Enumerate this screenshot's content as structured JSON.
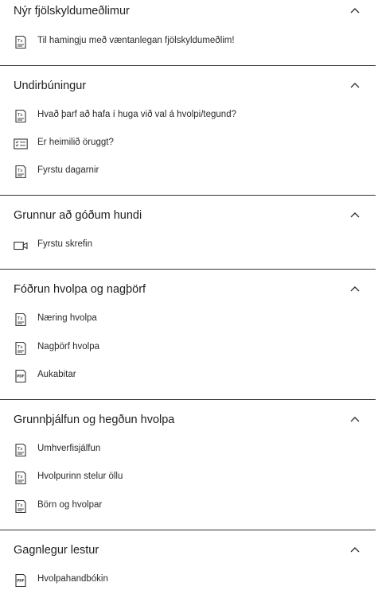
{
  "sections": [
    {
      "title": "Nýr fjölskyldumeðlimur",
      "items": [
        {
          "label": "Til hamingju með væntanlegan fjölskyldumeðlim!",
          "icon": "text-document-icon"
        }
      ]
    },
    {
      "title": "Undirbúningur",
      "items": [
        {
          "label": "Hvað þarf að hafa í huga við val á hvolpi/tegund?",
          "icon": "text-document-icon"
        },
        {
          "label": "Er heimilið öruggt?",
          "icon": "checklist-icon"
        },
        {
          "label": "Fyrstu dagarnir",
          "icon": "text-document-icon"
        }
      ]
    },
    {
      "title": "Grunnur að góðum hundi",
      "items": [
        {
          "label": "Fyrstu skrefin",
          "icon": "video-icon"
        }
      ]
    },
    {
      "title": "Fóðrun hvolpa og nagþörf",
      "items": [
        {
          "label": "Næring hvolpa",
          "icon": "text-document-icon"
        },
        {
          "label": "Nagþörf hvolpa",
          "icon": "text-document-icon"
        },
        {
          "label": "Aukabitar",
          "icon": "pdf-document-icon"
        }
      ]
    },
    {
      "title": "Grunnþjálfun og hegðun hvolpa",
      "items": [
        {
          "label": "Umhverfisjálfun",
          "icon": "text-document-icon"
        },
        {
          "label": "Hvolpurinn stelur öllu",
          "icon": "text-document-icon"
        },
        {
          "label": "Börn og hvolpar",
          "icon": "text-document-icon"
        }
      ]
    },
    {
      "title": "Gagnlegur lestur",
      "items": [
        {
          "label": "Hvolpahandbókin",
          "icon": "pdf-document-icon"
        }
      ]
    }
  ]
}
